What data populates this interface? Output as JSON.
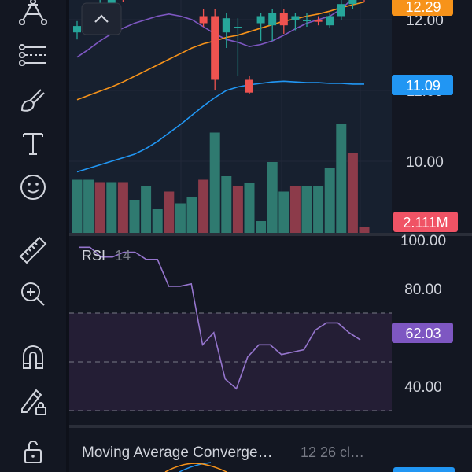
{
  "toolbar": {
    "tools": [
      {
        "name": "pattern-tool-icon"
      },
      {
        "name": "trend-line-tool-icon"
      },
      {
        "name": "brush-tool-icon"
      },
      {
        "name": "text-tool-icon"
      },
      {
        "name": "emoji-tool-icon"
      },
      {
        "name": "ruler-tool-icon"
      },
      {
        "name": "zoom-in-tool-icon"
      },
      {
        "name": "magnet-tool-icon"
      },
      {
        "name": "lock-drawing-tool-icon"
      },
      {
        "name": "unlock-icon"
      }
    ]
  },
  "collapse_button": {
    "icon": "chevron-up-icon"
  },
  "price_axis": {
    "labels": [
      "12.00",
      "11.00",
      "10.00"
    ],
    "badges": {
      "last_price": {
        "text": "12.29",
        "color": "#f7931a"
      },
      "moving_average": {
        "text": "11.09",
        "color": "#2196f3"
      },
      "volume": {
        "text": "2.111M",
        "color": "#f05365"
      }
    }
  },
  "rsi_pane": {
    "title": "RSI",
    "period": "14",
    "axis_labels": [
      "100.00",
      "80.00",
      "40.00"
    ],
    "badge": {
      "text": "62.03",
      "color": "#7e57c2"
    },
    "values": [
      97,
      97,
      93,
      93,
      95,
      95,
      92,
      92,
      81,
      81,
      82,
      57,
      62,
      43,
      39,
      52,
      57,
      57,
      53,
      54,
      55,
      63,
      66,
      66,
      62,
      59
    ]
  },
  "macd_pane": {
    "title": "Moving Average Converge…",
    "params": "12 26 cl…"
  },
  "colors": {
    "background": "#131722",
    "up": "#26a69a",
    "down": "#ef5350",
    "ma_orange": "#f7931a",
    "ma_blue": "#2196f3",
    "ma_purple": "#7e57c2",
    "rsi_line": "#9575cd"
  },
  "price_data": {
    "candles": [
      {
        "o": 11.82,
        "h": 11.98,
        "l": 11.72,
        "c": 11.91
      },
      {
        "o": 11.91,
        "h": 12.08,
        "l": 11.84,
        "c": 12.02
      },
      {
        "o": 12.02,
        "h": 12.35,
        "l": 11.95,
        "c": 12.2
      },
      {
        "o": 12.2,
        "h": 12.42,
        "l": 12.1,
        "c": 12.35
      },
      {
        "o": 12.35,
        "h": 12.42,
        "l": 12.25,
        "c": 12.34
      },
      {
        "o": 12.34,
        "h": 12.45,
        "l": 12.28,
        "c": 12.4
      },
      {
        "o": 12.4,
        "h": 12.5,
        "l": 12.3,
        "c": 12.36
      },
      {
        "o": 12.36,
        "h": 12.45,
        "l": 12.3,
        "c": 12.4
      },
      {
        "o": 12.4,
        "h": 12.48,
        "l": 12.32,
        "c": 12.36
      },
      {
        "o": 12.36,
        "h": 12.5,
        "l": 12.3,
        "c": 12.42
      },
      {
        "o": 12.42,
        "h": 12.45,
        "l": 12.3,
        "c": 12.34
      },
      {
        "o": 12.05,
        "h": 12.15,
        "l": 11.9,
        "c": 11.95
      },
      {
        "o": 12.05,
        "h": 12.15,
        "l": 11.0,
        "c": 11.15
      },
      {
        "o": 11.82,
        "h": 12.1,
        "l": 11.6,
        "c": 12.02
      },
      {
        "o": 11.9,
        "h": 12.02,
        "l": 11.2,
        "c": 11.9
      },
      {
        "o": 11.15,
        "h": 11.2,
        "l": 10.95,
        "c": 10.97
      },
      {
        "o": 11.95,
        "h": 12.1,
        "l": 11.7,
        "c": 12.05
      },
      {
        "o": 11.92,
        "h": 12.15,
        "l": 11.7,
        "c": 12.1
      },
      {
        "o": 12.1,
        "h": 12.15,
        "l": 11.8,
        "c": 11.92
      },
      {
        "o": 12.0,
        "h": 12.1,
        "l": 11.85,
        "c": 12.05
      },
      {
        "o": 11.98,
        "h": 12.1,
        "l": 11.9,
        "c": 12.0
      },
      {
        "o": 12.0,
        "h": 12.05,
        "l": 11.92,
        "c": 11.97
      },
      {
        "o": 11.92,
        "h": 12.1,
        "l": 11.88,
        "c": 12.05
      },
      {
        "o": 12.05,
        "h": 12.3,
        "l": 12.0,
        "c": 12.22
      },
      {
        "o": 12.22,
        "h": 12.4,
        "l": 12.15,
        "c": 12.35
      },
      {
        "o": 12.35,
        "h": 12.42,
        "l": 12.25,
        "c": 12.3
      }
    ],
    "ma_orange": [
      10.87,
      10.93,
      10.99,
      11.05,
      11.12,
      11.2,
      11.28,
      11.36,
      11.44,
      11.52,
      11.6,
      11.66,
      11.7,
      11.75,
      11.78,
      11.83,
      11.88,
      11.93,
      11.98,
      12.01,
      12.05,
      12.08,
      12.12,
      12.17,
      12.21,
      12.25
    ],
    "ma_blue": [
      9.85,
      9.9,
      9.95,
      10.0,
      10.05,
      10.1,
      10.18,
      10.28,
      10.4,
      10.52,
      10.65,
      10.78,
      10.9,
      11.0,
      11.05,
      11.08,
      11.1,
      11.12,
      11.13,
      11.12,
      11.11,
      11.11,
      11.1,
      11.1,
      11.09,
      11.09
    ],
    "ma_purple": [
      11.47,
      11.58,
      11.7,
      11.8,
      11.88,
      11.95,
      12.0,
      12.05,
      12.08,
      12.05,
      12.0,
      11.9,
      11.8,
      11.72,
      11.68,
      11.62,
      11.65,
      11.7,
      11.78,
      11.87,
      11.95,
      12.0,
      12.05,
      12.15,
      12.3,
      12.4
    ]
  },
  "volume": [
    {
      "v": 0.45,
      "up": true
    },
    {
      "v": 0.45,
      "up": true
    },
    {
      "v": 0.43,
      "up": false
    },
    {
      "v": 0.43,
      "up": true
    },
    {
      "v": 0.43,
      "up": false
    },
    {
      "v": 0.28,
      "up": true
    },
    {
      "v": 0.4,
      "up": true
    },
    {
      "v": 0.2,
      "up": true
    },
    {
      "v": 0.35,
      "up": false
    },
    {
      "v": 0.25,
      "up": true
    },
    {
      "v": 0.3,
      "up": true
    },
    {
      "v": 0.45,
      "up": false
    },
    {
      "v": 0.85,
      "up": true
    },
    {
      "v": 0.48,
      "up": true
    },
    {
      "v": 0.4,
      "up": false
    },
    {
      "v": 0.42,
      "up": true
    },
    {
      "v": 0.1,
      "up": true
    },
    {
      "v": 0.6,
      "up": true
    },
    {
      "v": 0.35,
      "up": true
    },
    {
      "v": 0.4,
      "up": false
    },
    {
      "v": 0.4,
      "up": true
    },
    {
      "v": 0.4,
      "up": true
    },
    {
      "v": 0.55,
      "up": true
    },
    {
      "v": 0.92,
      "up": true
    },
    {
      "v": 0.68,
      "up": false
    },
    {
      "v": 0.05,
      "up": false
    }
  ]
}
